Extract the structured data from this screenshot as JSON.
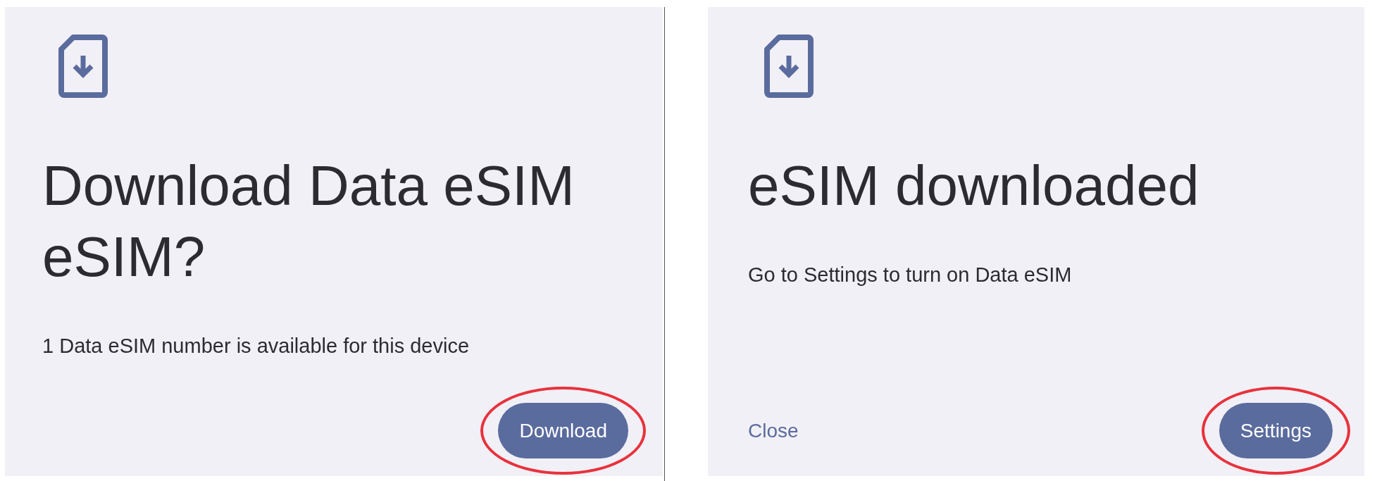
{
  "dialogs": [
    {
      "title": "Download Data eSIM eSIM?",
      "message": "1 Data eSIM number is available for this device",
      "actions": [
        {
          "label": "Download",
          "kind": "filled",
          "highlighted": true
        }
      ]
    },
    {
      "title": "eSIM downloaded",
      "message": "Go to Settings to turn on Data eSIM",
      "actions": [
        {
          "label": "Close",
          "kind": "text"
        },
        {
          "label": "Settings",
          "kind": "filled",
          "highlighted": true
        }
      ]
    }
  ]
}
